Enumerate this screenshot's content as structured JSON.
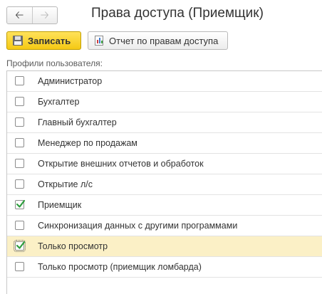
{
  "header": {
    "title": "Права доступа (Приемщик)",
    "nav_back_icon": "arrow-left-icon",
    "nav_forward_icon": "arrow-right-icon"
  },
  "toolbar": {
    "save_label": "Записать",
    "save_icon": "floppy-disk-icon",
    "report_label": "Отчет по правам доступа",
    "report_icon": "report-chart-icon"
  },
  "profiles": {
    "label": "Профили пользователя:",
    "items": [
      {
        "label": "Администратор",
        "checked": false,
        "selected": false
      },
      {
        "label": "Бухгалтер",
        "checked": false,
        "selected": false
      },
      {
        "label": "Главный бухгалтер",
        "checked": false,
        "selected": false
      },
      {
        "label": "Менеджер по продажам",
        "checked": false,
        "selected": false
      },
      {
        "label": "Открытие внешних отчетов и обработок",
        "checked": false,
        "selected": false
      },
      {
        "label": "Открытие л/с",
        "checked": false,
        "selected": false
      },
      {
        "label": "Приемщик",
        "checked": true,
        "selected": false
      },
      {
        "label": "Синхронизация данных с другими программами",
        "checked": false,
        "selected": false
      },
      {
        "label": "Только просмотр",
        "checked": true,
        "selected": true
      },
      {
        "label": "Только просмотр (приемщик ломбарда)",
        "checked": false,
        "selected": false
      }
    ]
  },
  "colors": {
    "accent_yellow": "#f5c914",
    "check_green": "#2e9e3e",
    "selected_row": "#fbf0c6"
  }
}
